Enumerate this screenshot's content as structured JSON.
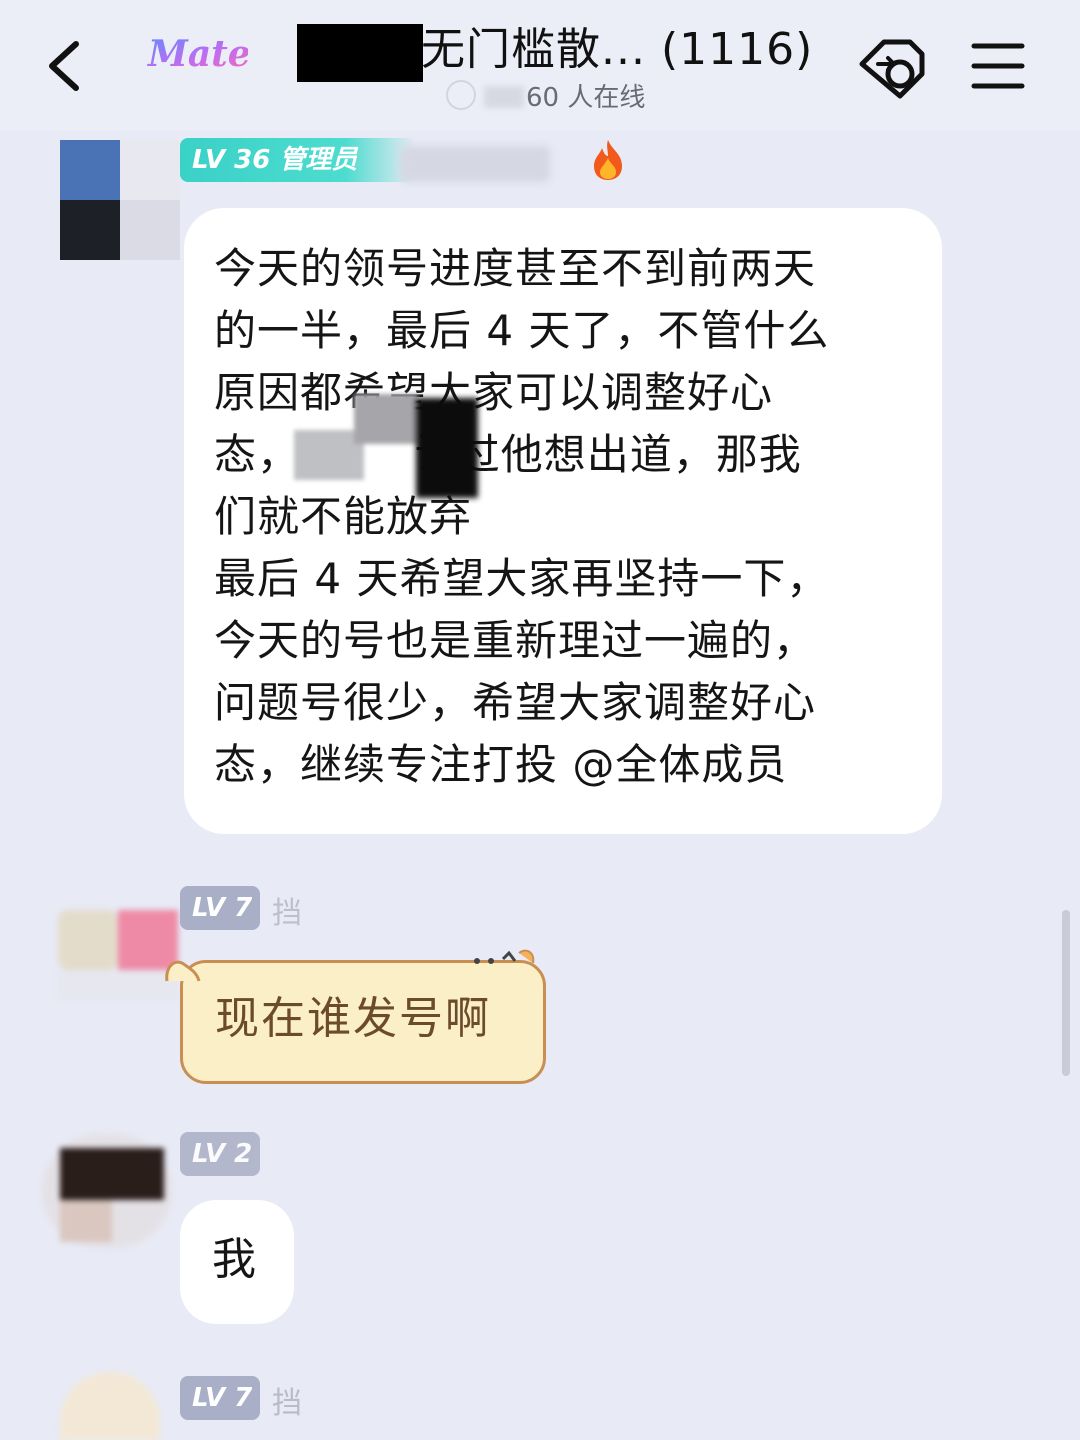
{
  "header": {
    "app_logo_text": "Matey",
    "title": "无门槛散... (1116)",
    "online_count": "60 人在线"
  },
  "messages": [
    {
      "badge": "LV 36 管理员",
      "text": "今天的领号进度甚至不到前两天\n的一半，最后 4 天了，不管什么\n原因都希望大家可以调整好心\n态，        说过他想出道，那我\n们就不能放弃\n最后 4 天希望大家再坚持一下，\n今天的号也是重新理过一遍的，\n问题号很少，希望大家调整好心\n态，继续专注打投 @全体成员"
    },
    {
      "badge": "LV 7",
      "name_fragment": "挡",
      "text": "现在谁发号啊",
      "bubble_style": "cat-sticker"
    },
    {
      "badge": "LV 2",
      "text": "我"
    },
    {
      "badge": "LV 7",
      "name_fragment": "挡"
    }
  ],
  "icons": {
    "back": "chevron-left-icon",
    "tag": "tag-icon",
    "menu": "hamburger-menu-icon",
    "fire": "fire-icon"
  },
  "colors": {
    "background": "#e8eaf5",
    "admin_badge": "#3ad1c7",
    "level_badge": "#a9afc6",
    "cat_bubble": "#fbefc8"
  }
}
